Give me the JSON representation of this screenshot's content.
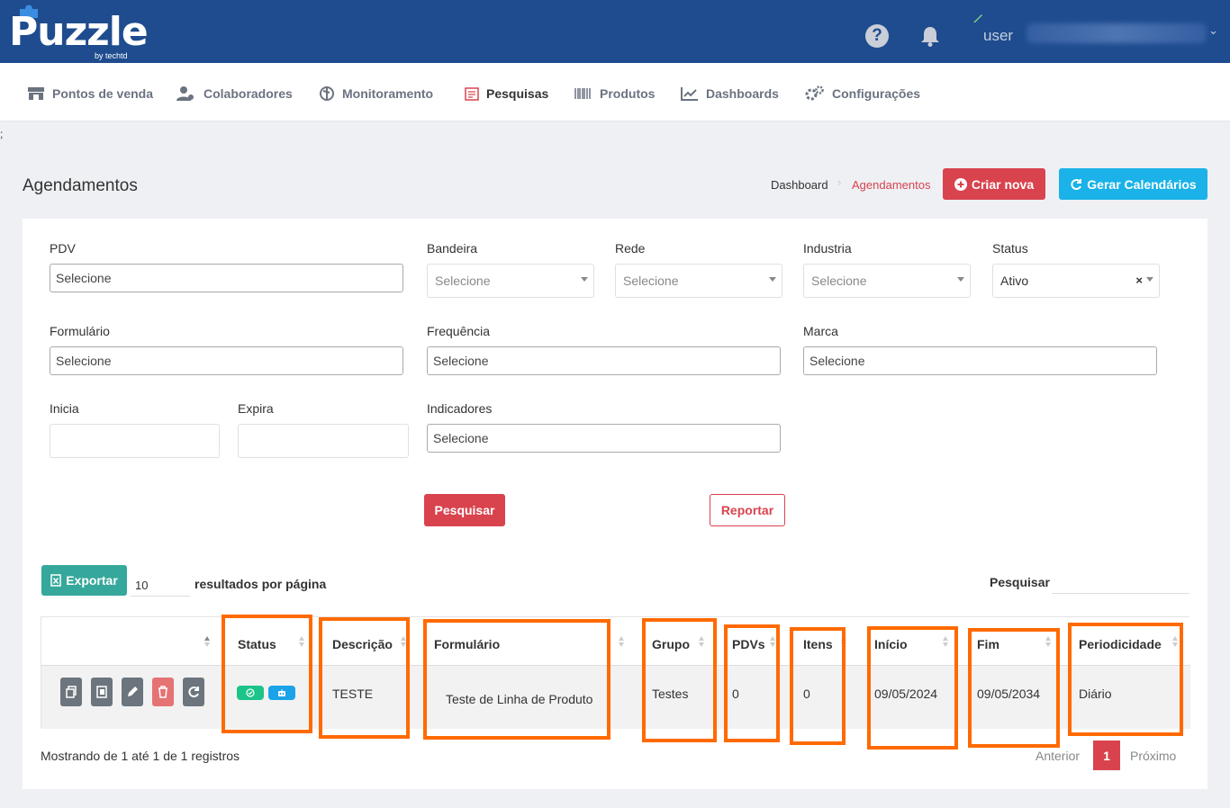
{
  "brand": {
    "name": "Puzzle",
    "sub": "by techtd"
  },
  "header": {
    "user_label": "user",
    "help_glyph": "?"
  },
  "nav": {
    "items": [
      {
        "label": "Pontos de venda",
        "icon": "store-icon"
      },
      {
        "label": "Colaboradores",
        "icon": "users-icon"
      },
      {
        "label": "Monitoramento",
        "icon": "globe-icon"
      },
      {
        "label": "Pesquisas",
        "icon": "form-icon"
      },
      {
        "label": "Produtos",
        "icon": "barcode-icon"
      },
      {
        "label": "Dashboards",
        "icon": "chart-icon"
      },
      {
        "label": "Configurações",
        "icon": "gears-icon"
      }
    ],
    "active": "Pesquisas"
  },
  "stray_text": ";",
  "page": {
    "title": "Agendamentos",
    "breadcrumb": [
      "Dashboard",
      "Agendamentos"
    ],
    "create_button": "Criar nova",
    "calendar_button": "Gerar Calendários"
  },
  "filters": {
    "pdv": {
      "label": "PDV",
      "value": "Selecione"
    },
    "bandeira": {
      "label": "Bandeira",
      "value": "Selecione"
    },
    "rede": {
      "label": "Rede",
      "value": "Selecione"
    },
    "industria": {
      "label": "Industria",
      "value": "Selecione"
    },
    "status": {
      "label": "Status",
      "value": "Ativo",
      "clear": "×"
    },
    "formulario": {
      "label": "Formulário",
      "value": "Selecione"
    },
    "frequencia": {
      "label": "Frequência",
      "value": "Selecione"
    },
    "marca": {
      "label": "Marca",
      "value": "Selecione"
    },
    "inicia": {
      "label": "Inicia",
      "value": ""
    },
    "expira": {
      "label": "Expira",
      "value": ""
    },
    "indicadores": {
      "label": "Indicadores",
      "value": "Selecione"
    },
    "search_button": "Pesquisar",
    "report_button": "Reportar"
  },
  "table_controls": {
    "export_button": "Exportar",
    "page_size": "10",
    "page_size_label": "resultados por página",
    "search_label": "Pesquisar",
    "search_value": ""
  },
  "table": {
    "columns": [
      "Status",
      "Descrição",
      "Formulário",
      "Grupo",
      "PDVs",
      "Itens",
      "Início",
      "Fim",
      "Periodicidade"
    ],
    "rows": [
      {
        "status_icons": [
          "check-circle-icon",
          "robot-icon"
        ],
        "descricao": "TESTE",
        "formulario": "Teste de Linha de Produto",
        "grupo": "Testes",
        "pdvs": "0",
        "itens": "0",
        "inicio": "09/05/2024",
        "fim": "09/05/2034",
        "periodicidade": "Diário"
      }
    ],
    "row_actions": [
      "copy-icon",
      "clone-icon",
      "edit-icon",
      "trash-icon",
      "refresh-icon"
    ]
  },
  "footer": {
    "info": "Mostrando de 1 até 1 de 1 registros",
    "prev": "Anterior",
    "current_page": "1",
    "next": "Próximo"
  },
  "colors": {
    "header_bg": "#1e4c8e",
    "primary_red": "#d9434e",
    "info_blue": "#1ab2e8",
    "export_teal": "#35a89b",
    "highlight_orange": "#ff6a00"
  }
}
